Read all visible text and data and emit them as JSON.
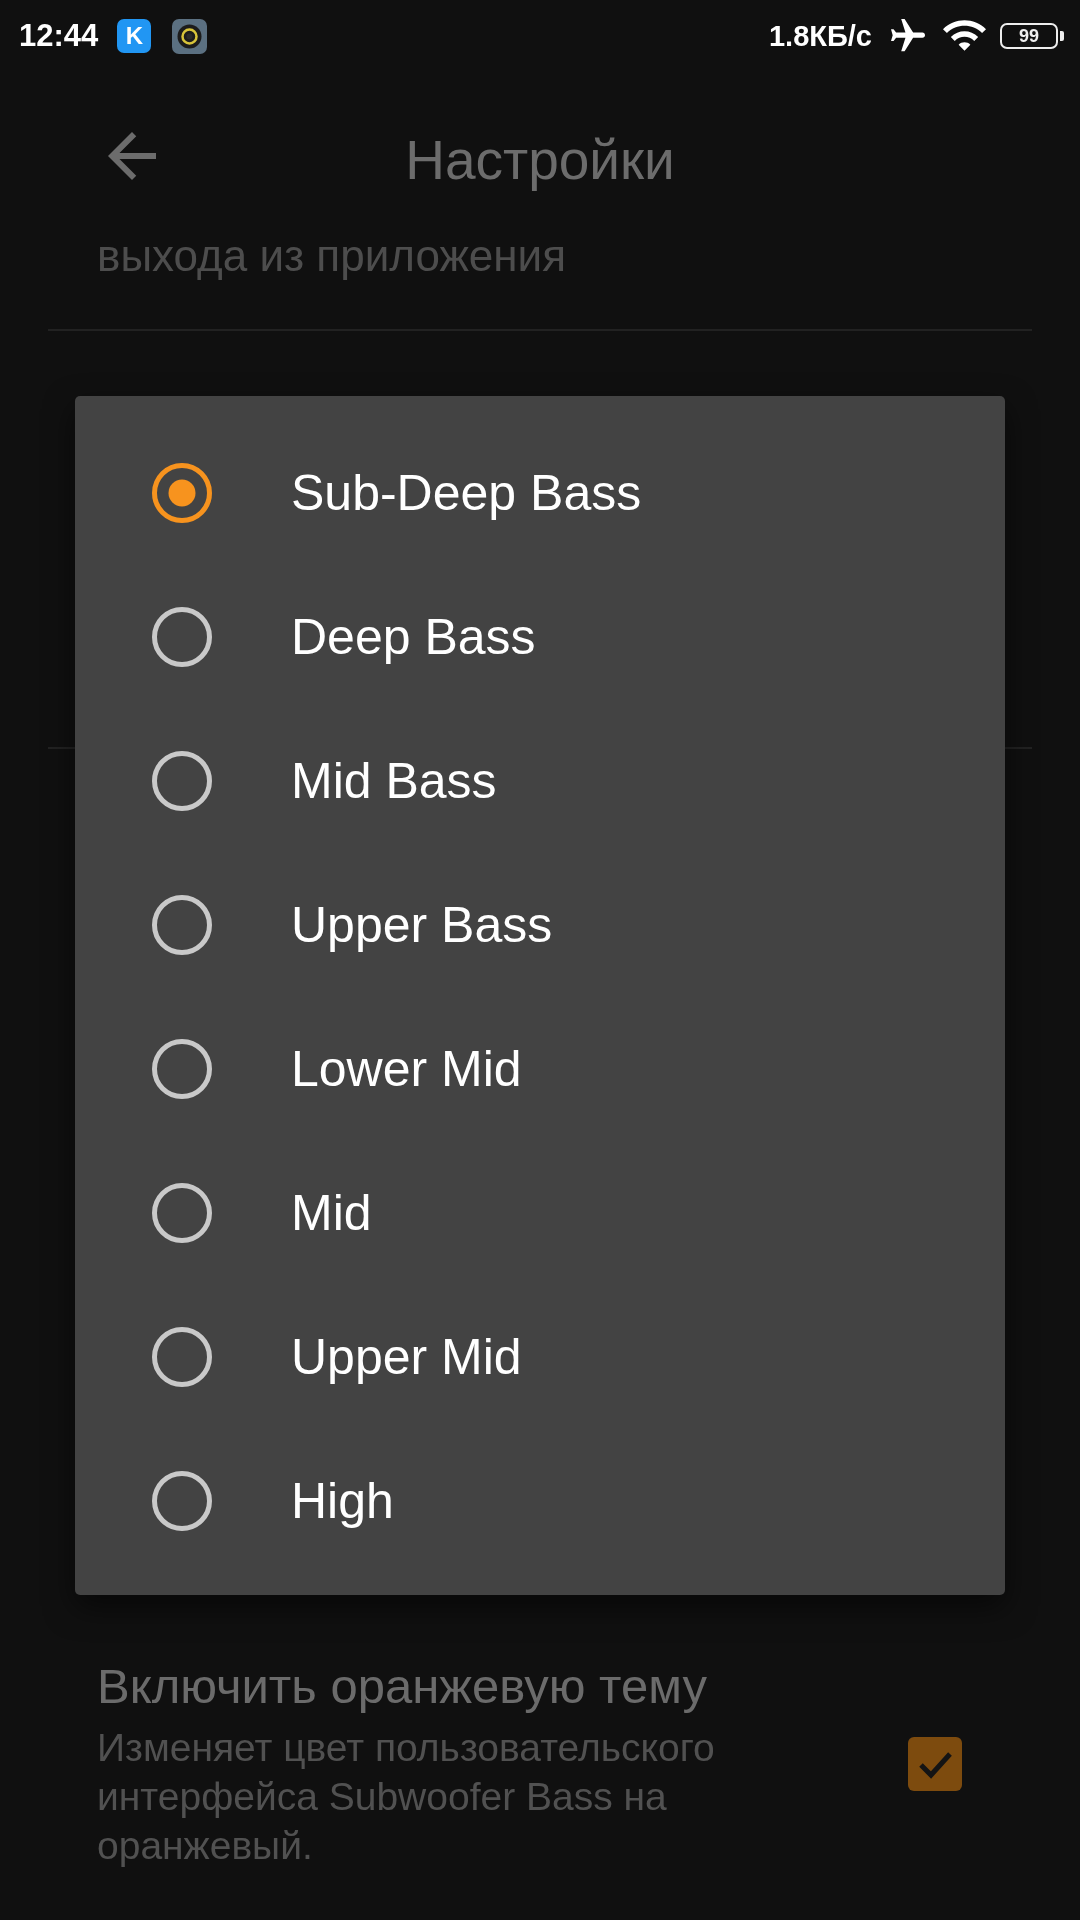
{
  "status_bar": {
    "time": "12:44",
    "app_icon_letter": "K",
    "network_speed": "1.8КБ/с",
    "battery": "99"
  },
  "toolbar": {
    "title": "Настройки"
  },
  "settings": {
    "partial_summary": "выхода из приложения",
    "theme_setting": {
      "title": "Включить оранжевую тему",
      "summary": "Изменяет цвет пользовательского интерфейса Subwoofer Bass на оранжевый.",
      "checked": true
    }
  },
  "dialog": {
    "options": [
      {
        "label": "Sub-Deep Bass",
        "selected": true
      },
      {
        "label": "Deep Bass",
        "selected": false
      },
      {
        "label": "Mid Bass",
        "selected": false
      },
      {
        "label": "Upper Bass",
        "selected": false
      },
      {
        "label": "Lower Mid",
        "selected": false
      },
      {
        "label": "Mid",
        "selected": false
      },
      {
        "label": "Upper Mid",
        "selected": false
      },
      {
        "label": "High",
        "selected": false
      }
    ]
  }
}
